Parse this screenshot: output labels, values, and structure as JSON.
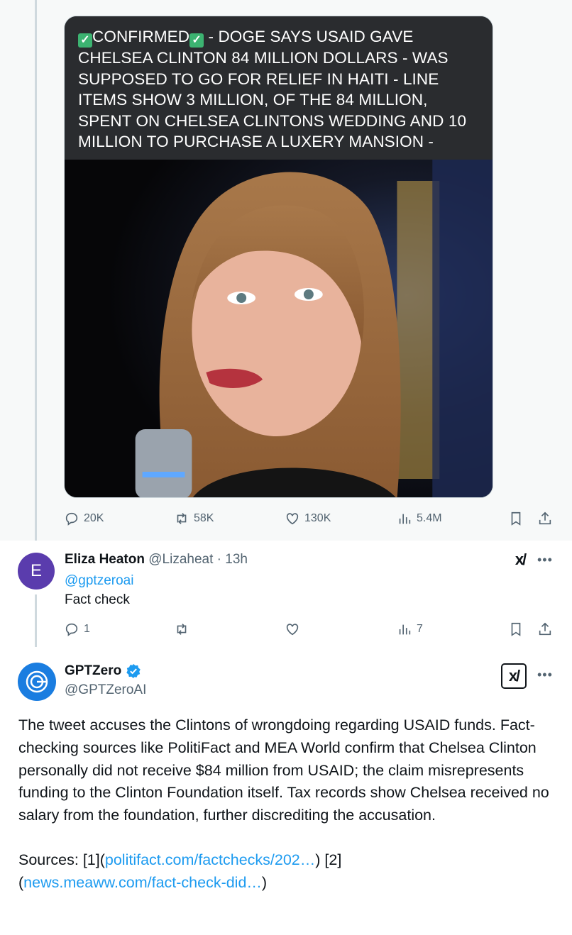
{
  "quoted_post": {
    "caption_parts": [
      "CONFIRMED",
      " - DOGE SAYS USAID GAVE CHELSEA CLINTON 84 MILLION DOLLARS - WAS SUPPOSED TO GO FOR RELIEF IN HAITI - LINE ITEMS SHOW 3  MILLION, OF THE 84 MILLION, SPENT ON CHELSEA CLINTONS WEDDING AND 10 MILLION TO PURCHASE A LUXERY MANSION -"
    ],
    "stats": {
      "replies": "20K",
      "reposts": "58K",
      "likes": "130K",
      "views": "5.4M"
    }
  },
  "reply_post": {
    "avatar_letter": "E",
    "display_name": "Eliza Heaton",
    "handle": "@Lizaheat",
    "separator": "·",
    "time": "13h",
    "mention": "@gptzeroai",
    "text": "Fact check",
    "stats": {
      "replies": "1",
      "views": "7"
    }
  },
  "gpt_post": {
    "display_name": "GPTZero",
    "handle": "@GPTZeroAI",
    "body": "The tweet accuses the Clintons of wrongdoing regarding USAID funds. Fact-checking sources like PolitiFact and MEA World confirm that Chelsea Clinton personally did not receive $84 million from USAID; the claim misrepresents funding to the Clinton Foundation itself. Tax records show Chelsea received no salary from the foundation, further discrediting the accusation.",
    "sources_label": "Sources: [1](",
    "source1": "politifact.com/factchecks/202…",
    "sources_mid": ") [2]",
    "source2_open": "(",
    "source2": "news.meaww.com/fact-check-did…",
    "source2_close": ")"
  },
  "icons": {
    "reply": "reply-icon",
    "repost": "repost-icon",
    "like": "heart-icon",
    "views": "views-icon",
    "bookmark": "bookmark-icon",
    "share": "share-icon",
    "grok": "grok-icon",
    "more": "more-icon",
    "verified": "verified-badge-icon"
  },
  "colors": {
    "link": "#1d9bf0",
    "muted": "#536471",
    "avatar_e": "#5a3cad",
    "gpt_blue": "#1a7de0"
  }
}
